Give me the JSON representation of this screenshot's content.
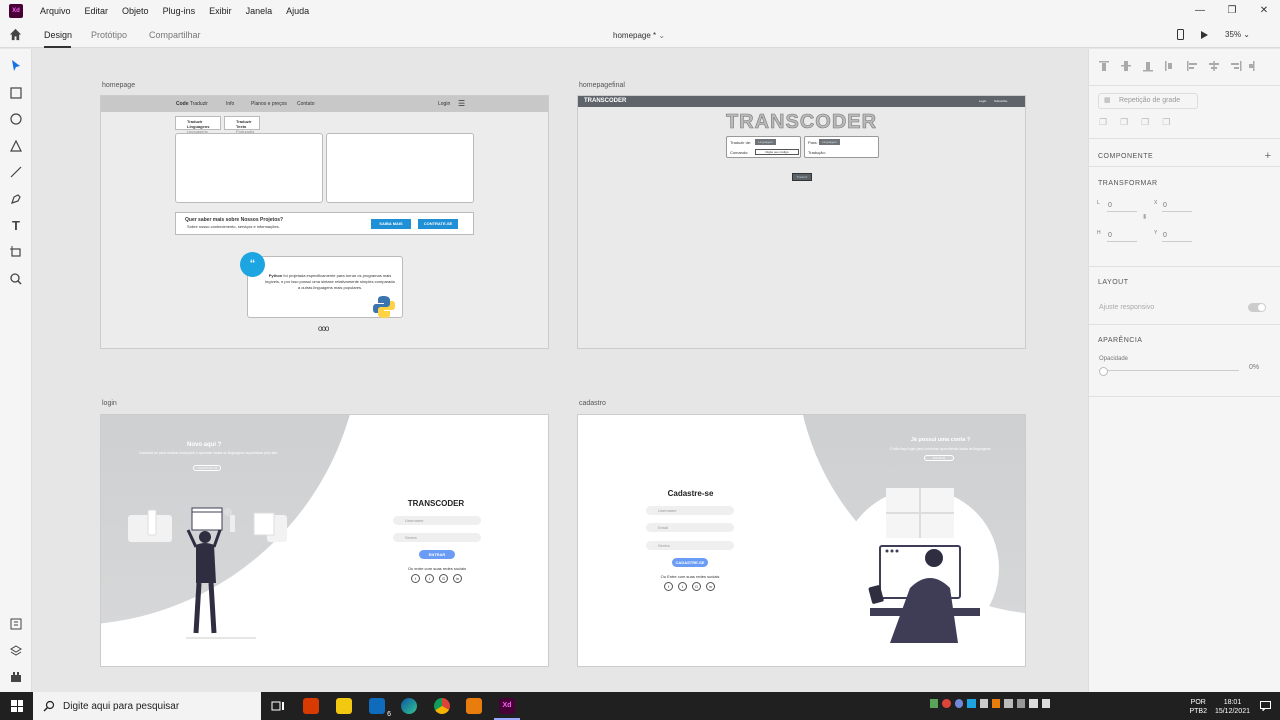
{
  "menubar": {
    "logo": "Xd",
    "items": [
      "Arquivo",
      "Editar",
      "Objeto",
      "Plug-ins",
      "Exibir",
      "Janela",
      "Ajuda"
    ]
  },
  "tabs": [
    "Design",
    "Protótipo",
    "Compartilhar"
  ],
  "doc_title": "homepage *",
  "zoom": "35%",
  "artboards": {
    "homepage": {
      "label": "homepage",
      "nav": {
        "brand_bold": "Code",
        "brand_rest": "Traduzir",
        "links": [
          "Info",
          "Planos e preços",
          "Contato"
        ],
        "login": "Login"
      },
      "chips": [
        {
          "title": "Traduzir Linguagens",
          "sub": "Linguagens"
        },
        {
          "title": "Traduzir Texto",
          "sub": "Português"
        }
      ],
      "banner": {
        "title": "Quer saber mais sobre Nossos Projetos?",
        "subtitle": "Sobre nosso conhecimento, serviços e informações.",
        "btn1": "SAIBA MAIS",
        "btn2": "CONTRATE-SE"
      },
      "quote": {
        "mark": "“",
        "bold": "Python",
        "text": "foi projetada especificamente para tornar os programas mais legíveis, e por isso possui uma sintaxe relativamente simples comparada a outras linguagens mais populares."
      },
      "dots": "ooo"
    },
    "homepagefinal": {
      "label": "homepagefinal",
      "nav": {
        "brand": "TRANSCODER",
        "links": [
          "Login",
          "Subscribe"
        ]
      },
      "title": "TRANSCODER",
      "box1": {
        "row1": "Traduzir de:",
        "row1_sel": "Linguagem",
        "row2": "Comando:",
        "row2_val": "Digite seu código"
      },
      "box2": {
        "row1": "Para:",
        "row1_sel": "Linguagem",
        "row2": "Tradução:"
      },
      "button": "Traduzir"
    },
    "login": {
      "label": "login",
      "side_title": "Novo aqui ?",
      "side_text": "Cadastre-se para realizar traduções e aprender todas as linguagens suportadas pelo site.",
      "side_btn": "CADASTRE-SE",
      "title": "TRANSCODER",
      "user_ph": "Username",
      "pass_ph": "Senha",
      "btn": "ENTRAR",
      "alt": "Ou entre com suas redes sociais",
      "socials": [
        "f",
        "t",
        "G",
        "in"
      ]
    },
    "cadastro": {
      "label": "cadastro",
      "side_title": "Já possui uma conta ?",
      "side_text": "Então faça login para continuar aprendendo todas as linguagens",
      "side_btn": "ENTRAR",
      "title": "Cadastre-se",
      "user_ph": "Username",
      "email_ph": "Email",
      "pass_ph": "Senha",
      "btn": "CADASTRE-SE",
      "alt": "Ou Entre com suas redes sociais",
      "socials": [
        "f",
        "t",
        "G",
        "in"
      ]
    }
  },
  "right_panel": {
    "repeat_grid": "Repetição de grade",
    "component": "COMPONENTE",
    "transform": "TRANSFORMAR",
    "w_label": "L",
    "w_val": "0",
    "x_label": "X",
    "x_val": "0",
    "h_label": "H",
    "h_val": "0",
    "y_label": "Y",
    "y_val": "0",
    "layout": "LAYOUT",
    "responsive": "Ajuste responsivo",
    "appearance": "APARÊNCIA",
    "opacity_label": "Opacidade",
    "opacity_val": "0%"
  },
  "taskbar": {
    "search_placeholder": "Digite aqui para pesquisar",
    "mail_badge": "6",
    "lang": "POR",
    "layout": "PTB2",
    "time": "18:01",
    "date": "15/12/2021"
  },
  "colors": {
    "accent_blue": "#1f8fd6",
    "xd_bg": "#470137",
    "xd_fg": "#ff61f6"
  }
}
